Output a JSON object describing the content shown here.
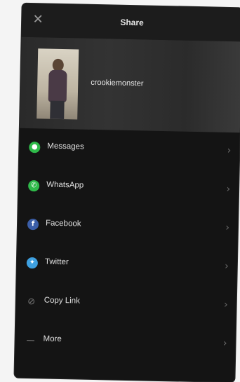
{
  "header": {
    "title": "Share",
    "close_icon": "close-icon"
  },
  "profile": {
    "username": "crookiemonster"
  },
  "share_options": [
    {
      "label": "Messages",
      "icon": "messages-icon"
    },
    {
      "label": "WhatsApp",
      "icon": "whatsapp-icon"
    },
    {
      "label": "Facebook",
      "icon": "facebook-icon"
    },
    {
      "label": "Twitter",
      "icon": "twitter-icon"
    },
    {
      "label": "Copy Link",
      "icon": "link-icon"
    },
    {
      "label": "More",
      "icon": "more-icon"
    }
  ],
  "colors": {
    "background": "#141414",
    "messages": "#2fba4a",
    "whatsapp": "#2fba4a",
    "facebook": "#3b5ea8",
    "twitter": "#3ea0e0"
  }
}
